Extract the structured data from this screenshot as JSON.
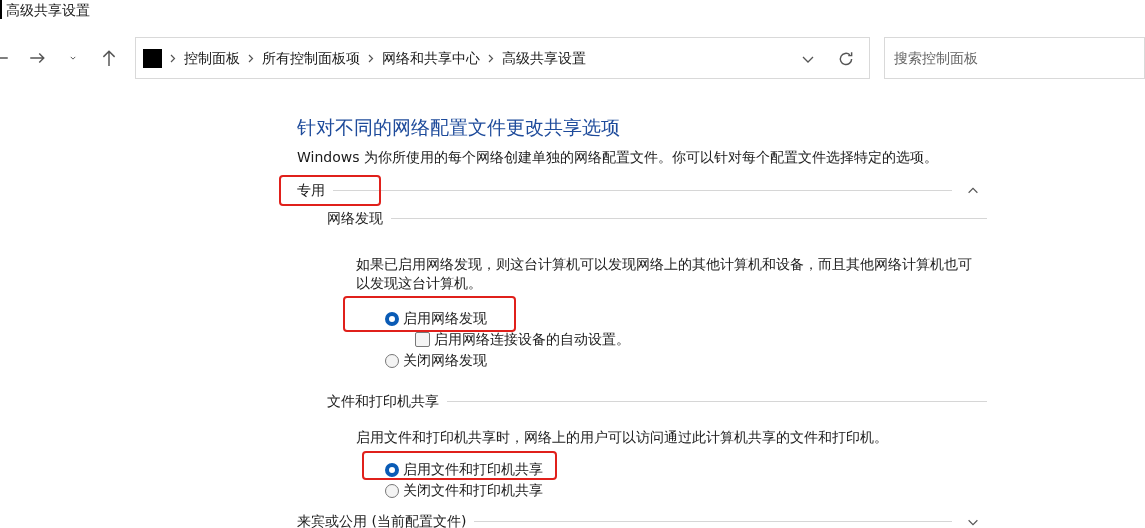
{
  "window": {
    "title": "高级共享设置"
  },
  "breadcrumb": [
    "控制面板",
    "所有控制面板项",
    "网络和共享中心",
    "高级共享设置"
  ],
  "search": {
    "placeholder": "搜索控制面板"
  },
  "heading": "针对不同的网络配置文件更改共享选项",
  "description": "Windows 为你所使用的每个网络创建单独的网络配置文件。你可以针对每个配置文件选择特定的选项。",
  "profiles": [
    {
      "label": "专用",
      "expanded": true,
      "highlighted": true,
      "groups": [
        {
          "title": "网络发现",
          "description": "如果已启用网络发现，则这台计算机可以发现网络上的其他计算机和设备，而且其他网络计算机也可以发现这台计算机。",
          "options": [
            {
              "kind": "radio",
              "label": "启用网络发现",
              "selected": true,
              "highlighted": true,
              "children": [
                {
                  "kind": "checkbox",
                  "label": "启用网络连接设备的自动设置。",
                  "checked": false
                }
              ]
            },
            {
              "kind": "radio",
              "label": "关闭网络发现",
              "selected": false,
              "highlighted": false
            }
          ]
        },
        {
          "title": "文件和打印机共享",
          "description": "启用文件和打印机共享时，网络上的用户可以访问通过此计算机共享的文件和打印机。",
          "options": [
            {
              "kind": "radio",
              "label": "启用文件和打印机共享",
              "selected": true,
              "highlighted": true
            },
            {
              "kind": "radio",
              "label": "关闭文件和打印机共享",
              "selected": false,
              "highlighted": false
            }
          ]
        }
      ]
    },
    {
      "label": "来宾或公用 (当前配置文件)",
      "expanded": false,
      "highlighted": false
    }
  ]
}
